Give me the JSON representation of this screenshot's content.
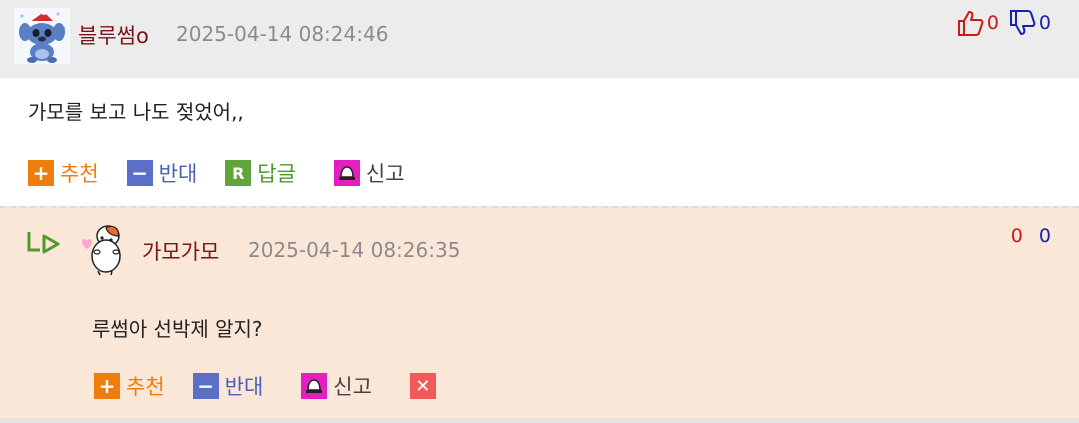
{
  "comment": {
    "author": "블루썸o",
    "timestamp": "2025-04-14 08:24:46",
    "likes": "0",
    "dislikes": "0",
    "text": "가모를 보고 나도 젖었어,,",
    "actions": {
      "recommend": "추천",
      "oppose": "반대",
      "reply_icon": "R",
      "reply": "답글",
      "report": "신고"
    }
  },
  "reply": {
    "author": "가모가모",
    "timestamp": "2025-04-14 08:26:35",
    "likes": "0",
    "dislikes": "0",
    "text": "루썸아 선박제 알지?",
    "actions": {
      "recommend": "추천",
      "oppose": "반대",
      "report": "신고",
      "delete_icon": "✕"
    }
  },
  "colors": {
    "header_bg": "#ececec",
    "reply_bg": "#fbe7d8",
    "author": "#7a1418",
    "like": "#d01818",
    "dislike": "#1822b0",
    "recommend": "#ef7d0c",
    "oppose": "#5b6fc9",
    "reply_green": "#5fa539",
    "report": "#e31fbf",
    "delete": "#f15a5a"
  },
  "icons": [
    "stitch-avatar",
    "thumbs-up-icon",
    "thumbs-down-icon",
    "plus-icon",
    "minus-icon",
    "reply-r-icon",
    "siren-icon",
    "reply-arrow-icon",
    "hamster-avatar",
    "close-icon"
  ]
}
